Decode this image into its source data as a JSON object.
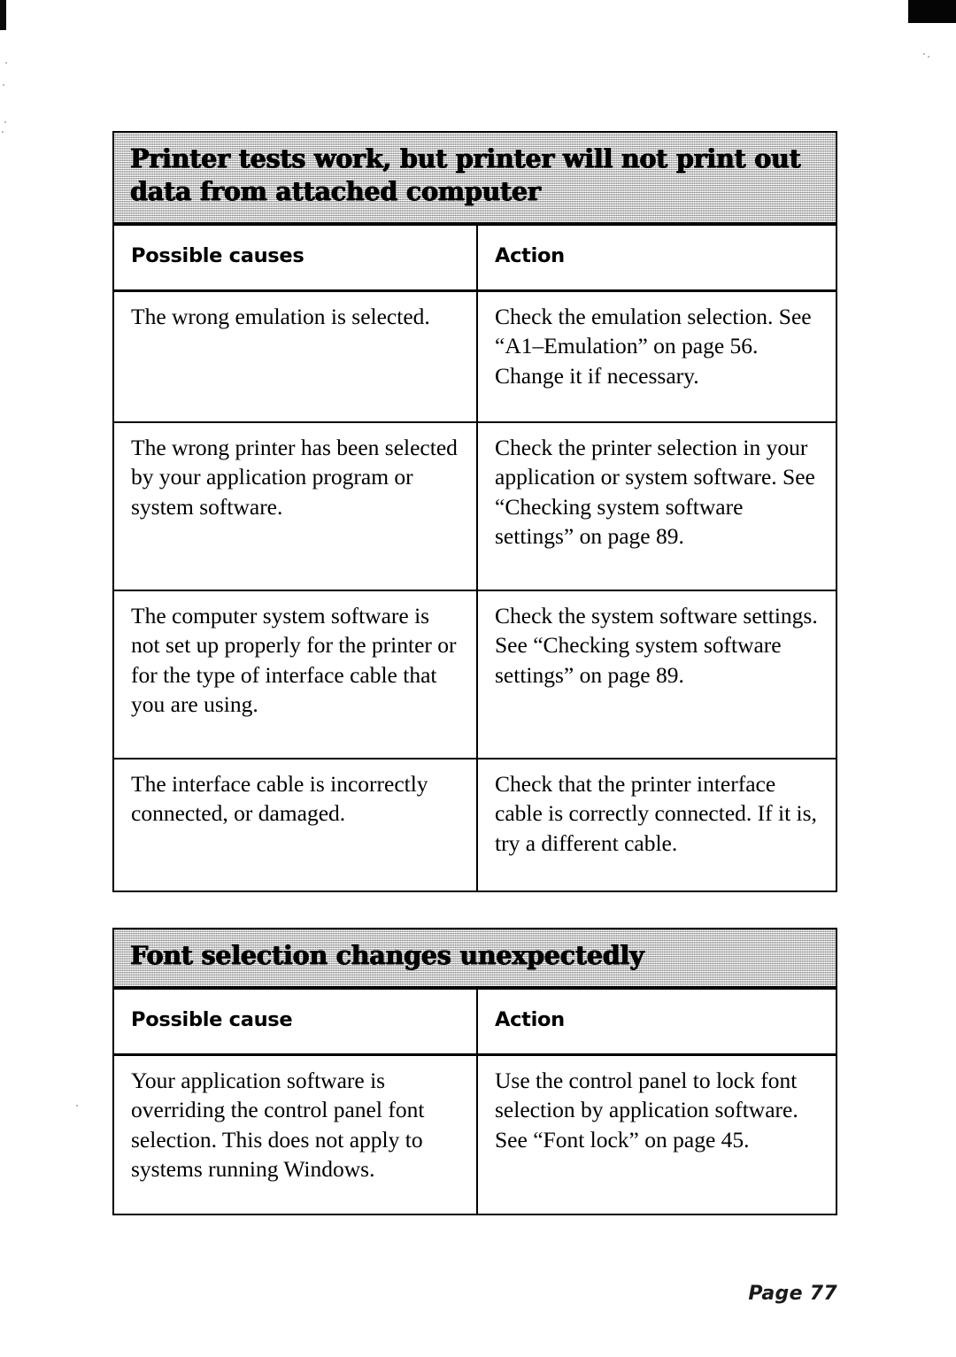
{
  "page": {
    "footer_label": "Page 77"
  },
  "tables": [
    {
      "banner_title": "Printer tests work, but printer will not print out data from attached computer",
      "columns": [
        "Possible causes",
        "Action"
      ],
      "rows": [
        {
          "cause": "The wrong emulation is selected.",
          "action": "Check the emulation selection. See “A1–Emulation” on page 56. Change it if necessary."
        },
        {
          "cause": "The wrong printer has been selected by your application program or system software.",
          "action": "Check the printer selection in your application or system software. See “Checking system software settings” on page 89."
        },
        {
          "cause": "The computer system software is not set up properly for the printer or for the type of interface cable that you are using.",
          "action": "Check the system software settings. See “Checking system software settings” on page 89."
        },
        {
          "cause": "The interface cable is incorrectly connected, or damaged.",
          "action": "Check that the printer interface cable is correctly connected. If it is, try a different cable."
        }
      ]
    },
    {
      "banner_title": "Font selection changes unexpectedly",
      "columns": [
        "Possible cause",
        "Action"
      ],
      "rows": [
        {
          "cause": "Your application software is overriding the control panel font selection. This does not apply to systems running Windows.",
          "action": "Use the control panel to lock font selection by application software. See “Font lock” on page 45."
        }
      ]
    }
  ],
  "colors": {
    "ink": "#000000",
    "paper": "#ffffff",
    "banner_fill": "#c9c9c9"
  }
}
